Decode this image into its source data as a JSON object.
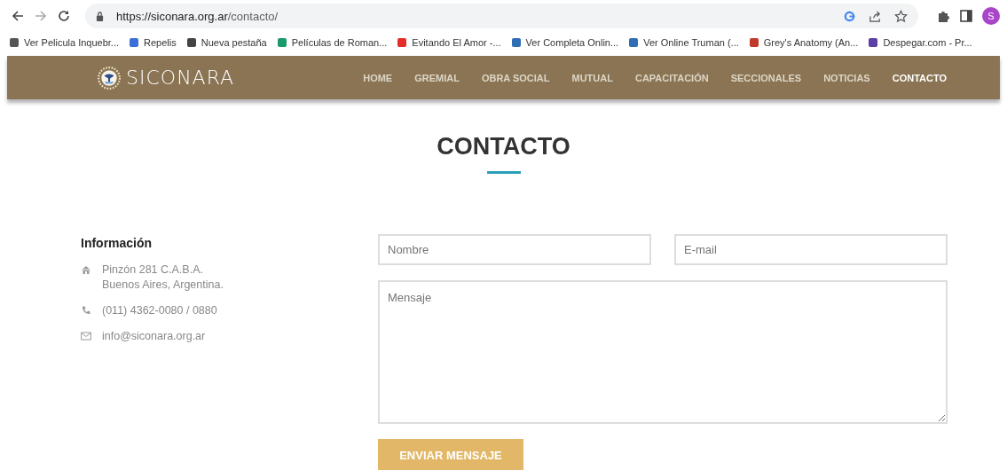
{
  "browser": {
    "url_host": "https://siconara.org.ar",
    "url_path": "/contacto/",
    "profile_initial": "S"
  },
  "bookmarks": [
    {
      "label": "Ver Pelicula Inquebr...",
      "color": "#555555"
    },
    {
      "label": "Repelis",
      "color": "#3a6fd8"
    },
    {
      "label": "Nueva pestaña",
      "color": "#444444"
    },
    {
      "label": "Películas de Roman...",
      "color": "#1a9a6a"
    },
    {
      "label": "Evitando El Amor -...",
      "color": "#e52d27"
    },
    {
      "label": "Ver Completa Onlin...",
      "color": "#2f6db5"
    },
    {
      "label": "Ver Online Truman (...",
      "color": "#2f6db5"
    },
    {
      "label": "Grey's Anatomy (An...",
      "color": "#c0392b"
    },
    {
      "label": "Despegar.com - Pr...",
      "color": "#5b3ea6"
    }
  ],
  "site": {
    "logo": "SICONARA",
    "nav": [
      {
        "label": "HOME",
        "selected": false
      },
      {
        "label": "GREMIAL",
        "selected": false
      },
      {
        "label": "OBRA SOCIAL",
        "selected": false
      },
      {
        "label": "MUTUAL",
        "selected": false
      },
      {
        "label": "CAPACITACIÓN",
        "selected": false
      },
      {
        "label": "SECCIONALES",
        "selected": false
      },
      {
        "label": "NOTICIAS",
        "selected": false
      },
      {
        "label": "CONTACTO",
        "selected": true
      }
    ]
  },
  "page_title": "CONTACTO",
  "info": {
    "heading": "Información",
    "items": [
      {
        "kind": "address",
        "lines": [
          "Pinzón 281 C.A.B.A.",
          "Buenos Aires, Argentina."
        ]
      },
      {
        "kind": "phone",
        "lines": [
          "(011) 4362-0080 / 0880"
        ]
      },
      {
        "kind": "email",
        "lines": [
          "info@siconara.org.ar"
        ]
      }
    ]
  },
  "form": {
    "name_placeholder": "Nombre",
    "email_placeholder": "E-mail",
    "message_placeholder": "Mensaje",
    "submit": "ENVIAR MENSAJE"
  }
}
